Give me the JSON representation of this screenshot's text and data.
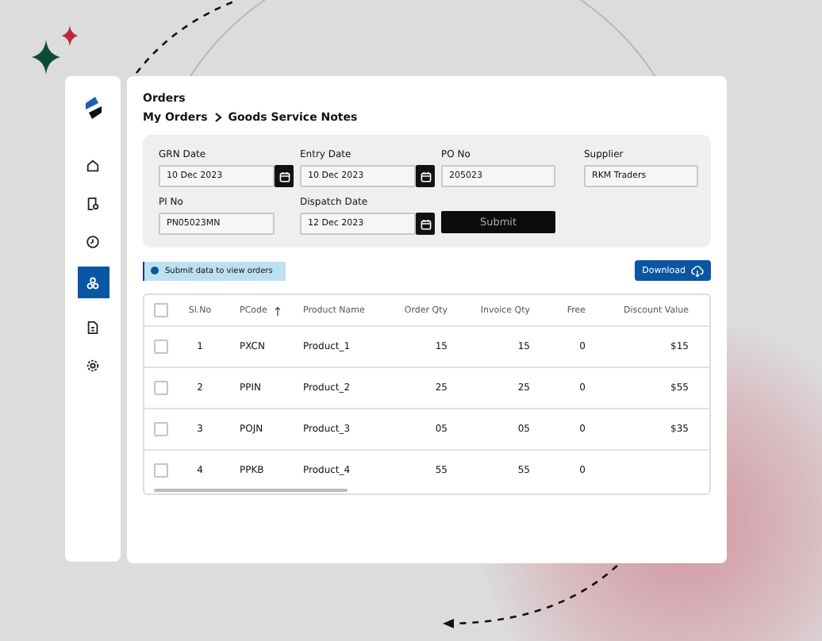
{
  "page": {
    "title": "Orders",
    "breadcrumb": [
      "My Orders",
      "Goods Service Notes"
    ]
  },
  "sidebar": {
    "items": [
      {
        "selected": false
      },
      {
        "selected": false
      },
      {
        "selected": false
      },
      {
        "selected": true
      },
      {
        "selected": false
      },
      {
        "selected": false
      }
    ]
  },
  "form": {
    "fields": [
      {
        "kind": "date",
        "label": "GRN Date",
        "value": "10 Dec 2023"
      },
      {
        "kind": "date",
        "label": "Entry Date",
        "value": "10 Dec 2023"
      },
      {
        "kind": "text",
        "label": "PO No",
        "value": "205023"
      },
      {
        "kind": "text",
        "label": "Supplier",
        "value": "RKM Traders"
      },
      {
        "kind": "text",
        "label": "PI No",
        "value": "PN05023MN"
      },
      {
        "kind": "date",
        "label": "Dispatch Date",
        "value": "12 Dec 2023"
      },
      {
        "kind": "button",
        "label": "Submit"
      }
    ]
  },
  "notice": "Submit data to view orders",
  "download_button": "Download",
  "table": {
    "all_checked": false,
    "columns": [
      {
        "label": "Sl.No",
        "sorted": false
      },
      {
        "label": "PCode",
        "sorted": true
      },
      {
        "label": "Product Name",
        "sorted": false
      },
      {
        "label": "Order Qty",
        "sorted": false
      },
      {
        "label": "Invoice Qty",
        "sorted": false
      },
      {
        "label": "Free",
        "sorted": false
      },
      {
        "label": "Discount Value",
        "sorted": false
      }
    ],
    "rows": [
      {
        "checked": false,
        "cells": [
          "1",
          "PXCN",
          "Product_1",
          "15",
          "15",
          "0",
          "$15"
        ]
      },
      {
        "checked": false,
        "cells": [
          "2",
          "PPIN",
          "Product_2",
          "25",
          "25",
          "0",
          "$55"
        ]
      },
      {
        "checked": false,
        "cells": [
          "3",
          "POJN",
          "Product_3",
          "05",
          "05",
          "0",
          "$35"
        ]
      },
      {
        "checked": false,
        "cells": [
          "4",
          "PPKB",
          "Product_4",
          "55",
          "55",
          "0"
        ]
      }
    ]
  }
}
